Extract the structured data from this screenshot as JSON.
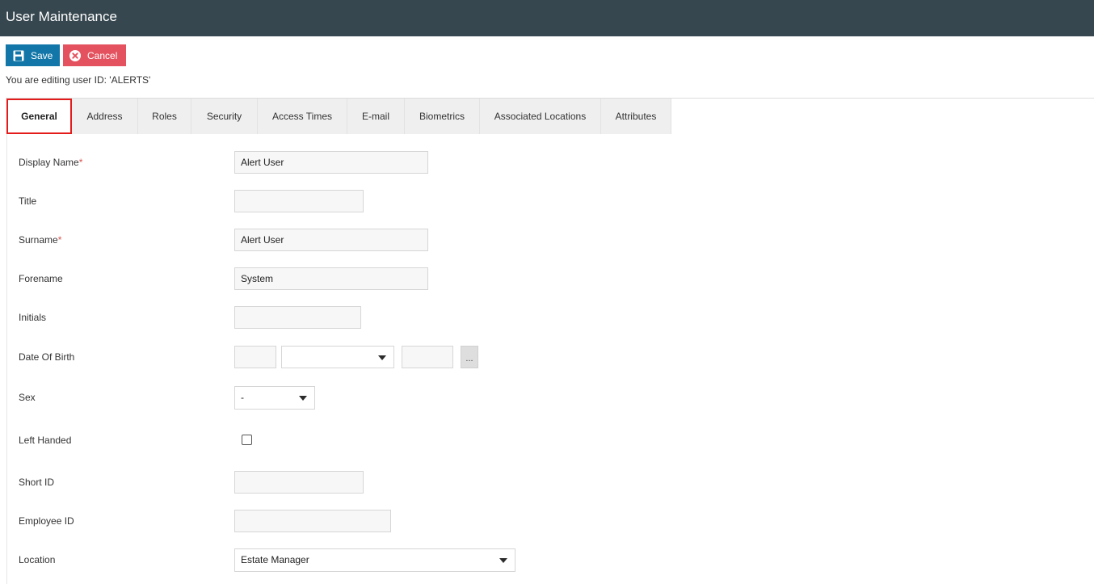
{
  "window": {
    "title": "User Maintenance"
  },
  "toolbar": {
    "save_label": "Save",
    "cancel_label": "Cancel",
    "save_icon": "floppy-disk-icon",
    "cancel_icon": "close-circle-icon",
    "save_color": "#1277a8",
    "cancel_color": "#e4525f"
  },
  "editing_note": "You are editing user ID: 'ALERTS'",
  "tabs": [
    {
      "label": "General",
      "active": true
    },
    {
      "label": "Address"
    },
    {
      "label": "Roles"
    },
    {
      "label": "Security"
    },
    {
      "label": "Access Times"
    },
    {
      "label": "E-mail"
    },
    {
      "label": "Biometrics"
    },
    {
      "label": "Associated Locations"
    },
    {
      "label": "Attributes"
    }
  ],
  "form": {
    "display_name": {
      "label": "Display Name",
      "required_mark": "*",
      "value": "Alert User"
    },
    "title": {
      "label": "Title",
      "value": ""
    },
    "surname": {
      "label": "Surname",
      "required_mark": "*",
      "value": "Alert User"
    },
    "forename": {
      "label": "Forename",
      "value": "System"
    },
    "initials": {
      "label": "Initials",
      "value": ""
    },
    "date_of_birth": {
      "label": "Date Of Birth",
      "day": "",
      "month": "",
      "year": "",
      "picker_label": "..."
    },
    "sex": {
      "label": "Sex",
      "value": "-"
    },
    "left_handed": {
      "label": "Left Handed",
      "checked": false
    },
    "short_id": {
      "label": "Short ID",
      "value": ""
    },
    "employee_id": {
      "label": "Employee ID",
      "value": ""
    },
    "location": {
      "label": "Location",
      "value": "Estate Manager"
    }
  },
  "colors": {
    "titlebar_bg": "#36474f",
    "active_tab_border": "#e41b1b",
    "required_mark": "#d9534f"
  }
}
